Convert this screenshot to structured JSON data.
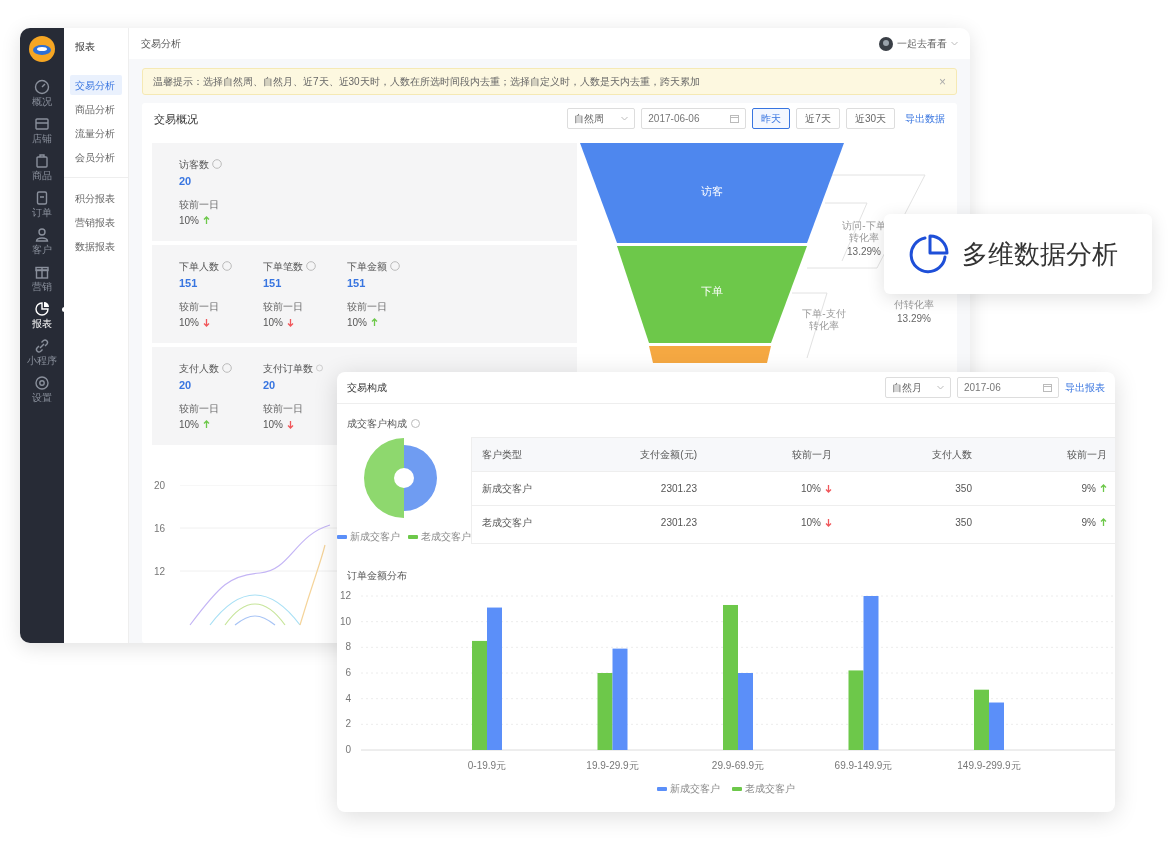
{
  "nav": {
    "items": [
      {
        "label": "概况",
        "selected": false
      },
      {
        "label": "店铺",
        "selected": false
      },
      {
        "label": "商品",
        "selected": false
      },
      {
        "label": "订单",
        "selected": false
      },
      {
        "label": "客户",
        "selected": false
      },
      {
        "label": "营销",
        "selected": false
      },
      {
        "label": "报表",
        "selected": true
      },
      {
        "label": "小程序",
        "selected": false
      },
      {
        "label": "设置",
        "selected": false
      }
    ]
  },
  "subnav": {
    "title": "报表",
    "groups": [
      [
        {
          "label": "交易分析",
          "selected": true
        },
        {
          "label": "商品分析",
          "selected": false
        },
        {
          "label": "流量分析",
          "selected": false
        },
        {
          "label": "会员分析",
          "selected": false
        }
      ],
      [
        {
          "label": "积分报表",
          "selected": false
        },
        {
          "label": "营销报表",
          "selected": false
        },
        {
          "label": "数据报表",
          "selected": false
        }
      ]
    ]
  },
  "topbar": {
    "title": "交易分析",
    "user": "一起去看看"
  },
  "notice": {
    "text": "温馨提示：选择自然周、自然月、近7天、近30天时，人数在所选时间段内去重；选择自定义时，人数是天内去重，跨天累加",
    "close": "×"
  },
  "overview": {
    "title": "交易概况",
    "period": "自然周",
    "date": "2017-06-06",
    "ranges": [
      {
        "label": "昨天",
        "selected": true
      },
      {
        "label": "近7天",
        "selected": false
      },
      {
        "label": "近30天",
        "selected": false
      }
    ],
    "export": "导出数据",
    "groups": [
      [
        {
          "label": "访客数",
          "value": "20",
          "compare": "较前一日",
          "change": "10%",
          "rising": true
        }
      ],
      [
        {
          "label": "下单人数",
          "value": "151",
          "compare": "较前一日",
          "change": "10%",
          "rising": false
        },
        {
          "label": "下单笔数",
          "value": "151",
          "compare": "较前一日",
          "change": "10%",
          "rising": false
        },
        {
          "label": "下单金额",
          "value": "151",
          "compare": "较前一日",
          "change": "10%",
          "rising": true
        }
      ],
      [
        {
          "label": "支付人数",
          "value": "20",
          "compare": "较前一日",
          "change": "10%",
          "rising": true
        },
        {
          "label": "支付订单数",
          "value": "20",
          "compare": "较前一日",
          "change": "10%",
          "rising": false
        }
      ]
    ],
    "funnel": {
      "stages": [
        "访客",
        "下单"
      ],
      "rates": [
        {
          "label": "访问-下单转化率",
          "value": "13.29%"
        },
        {
          "label": "付转化率",
          "value": "13.29%"
        },
        {
          "label": "下单-支付转化率"
        }
      ]
    },
    "line_chart": {
      "yticks": [
        "20",
        "16",
        "12"
      ]
    }
  },
  "callout": {
    "text": "多维数据分析"
  },
  "composition": {
    "title": "交易构成",
    "period": "自然月",
    "date": "2017-06",
    "export": "导出报表",
    "section": "成交客户构成",
    "legend": [
      {
        "label": "新成交客户",
        "color": "#5b8ff9"
      },
      {
        "label": "老成交客户",
        "color": "#6dc84a"
      }
    ],
    "table": {
      "columns": [
        "客户类型",
        "支付金额(元)",
        "较前一月",
        "支付人数",
        "较前一月"
      ],
      "rows": [
        {
          "cells": [
            "新成交客户",
            "2301.23",
            "10%",
            "350",
            "9%"
          ],
          "rising": [
            false,
            true
          ]
        },
        {
          "cells": [
            "老成交客户",
            "2301.23",
            "10%",
            "350",
            "9%"
          ],
          "rising": [
            false,
            true
          ]
        }
      ]
    },
    "bar_title": "订单金额分布",
    "chart_data": {
      "type": "bar",
      "categories": [
        "0-19.9元",
        "19.9-29.9元",
        "29.9-69.9元",
        "69.9-149.9元",
        "149.9-299.9元"
      ],
      "series": [
        {
          "name": "老成交客户",
          "color": "#6dc84a",
          "values": [
            8.5,
            6,
            11.3,
            6.2,
            4.7
          ]
        },
        {
          "name": "新成交客户",
          "color": "#5b8ff9",
          "values": [
            11.1,
            7.9,
            6,
            12,
            3.7
          ]
        }
      ],
      "grid": true,
      "ylim": [
        0,
        12
      ],
      "yticks": [
        0,
        2,
        4,
        6,
        8,
        10,
        12
      ]
    }
  }
}
